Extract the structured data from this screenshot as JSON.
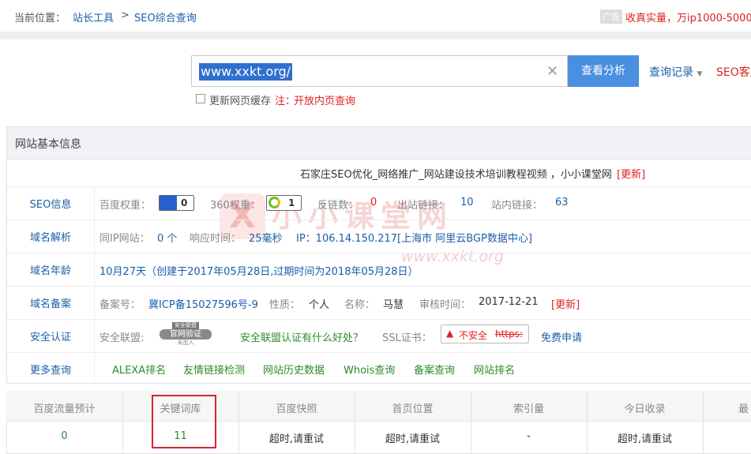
{
  "breadcrumb": {
    "prefix": "当前位置：",
    "item1": "站长工具",
    "sep": ">",
    "item2": "SEO综合查询"
  },
  "ad": {
    "tag": "广告",
    "text": "收真实量，万ip1000-5000"
  },
  "search": {
    "value": "www.xxkt.org/",
    "button": "查看分析",
    "history": "查询记录",
    "client": "SEO客户",
    "cache_label": "更新网页缓存",
    "note_prefix": "注：",
    "note_link": "开放内页查询"
  },
  "panel": {
    "title": "网站基本信息",
    "site_title": "石家庄SEO优化_网络推广_网站建设技术培训教程视频 ，小小课堂网",
    "update": "[更新]"
  },
  "seo": {
    "label": "SEO信息",
    "baidu_label": "百度权重：",
    "baidu_value": "0",
    "r360_label": "360权重：",
    "r360_value": "1",
    "backlinks_label": "反链数：",
    "backlinks_value": "0",
    "outlinks_label": "出站链接：",
    "outlinks_value": "10",
    "inlinks_label": "站内链接：",
    "inlinks_value": "63"
  },
  "domain": {
    "label": "域名解析",
    "sameip_label": "同IP网站：",
    "sameip_value": "0 个",
    "resp_label": "响应时间：",
    "resp_value": "25毫秒",
    "ip_text": "IP：106.14.150.217[上海市 阿里云BGP数据中心]"
  },
  "age": {
    "label": "域名年龄",
    "text": "10月27天（创建于2017年05月28日,过期时间为2018年05月28日）"
  },
  "record": {
    "label": "域名备案",
    "no_label": "备案号：",
    "no_value": "冀ICP备15027596号-9",
    "nature_label": "性质：",
    "nature_value": "个人",
    "name_label": "名称：",
    "name_value": "马慧",
    "time_label": "审核时间：",
    "time_value": "2017-12-21",
    "update": "[更新]"
  },
  "security": {
    "label": "安全认证",
    "alliance_label": "安全联盟:",
    "seal_top": "安全联盟",
    "seal_mid": "官网验证",
    "seal_bot": "未加入",
    "alliance_link": "安全联盟认证有什么好处？",
    "ssl_label": "SSL证书：",
    "unsafe": "不安全",
    "https": "https:",
    "free": "免费申请"
  },
  "more": {
    "label": "更多查询",
    "links": [
      "ALEXA排名",
      "友情链接检测",
      "网站历史数据",
      "Whois查询",
      "备案查询",
      "网站排名"
    ]
  },
  "table": {
    "headers": [
      "百度流量预计",
      "关键词库",
      "百度快照",
      "首页位置",
      "索引量",
      "今日收录",
      "最"
    ],
    "values": [
      "0",
      "11",
      "超时,请重试",
      "超时,请重试",
      "-",
      "超时,请重试",
      ""
    ]
  },
  "watermark": {
    "mark": "X",
    "cn": "小小课堂网",
    "url": "www.xxkt.org"
  },
  "colors": {
    "link": "#1a5ea8",
    "green": "#2d8a2d",
    "red": "#e02020",
    "button": "#4a8fe0",
    "highlight": "#d9232f"
  }
}
